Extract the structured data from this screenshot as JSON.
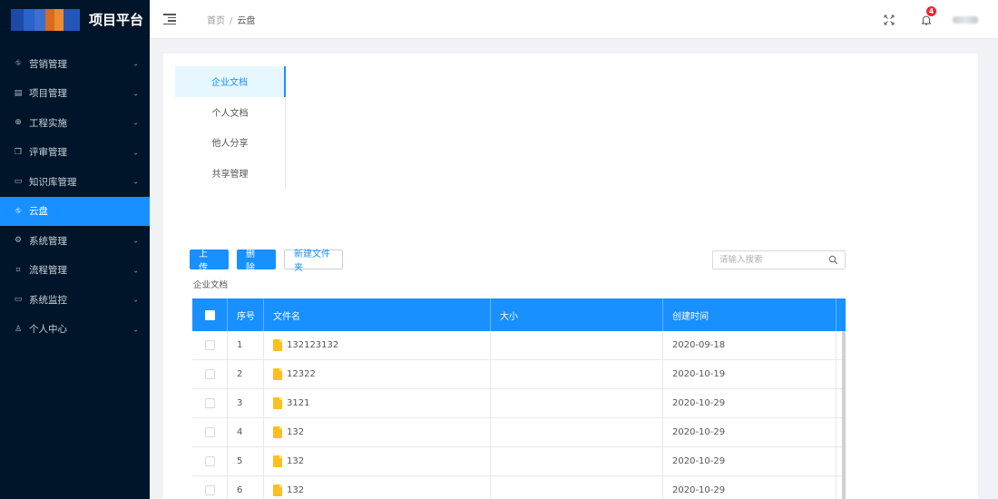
{
  "app": {
    "title": "项目平台"
  },
  "sidebar": {
    "items": [
      {
        "label": "营销管理",
        "icon": "cluster-icon",
        "glyph": "⛗",
        "active": false
      },
      {
        "label": "项目管理",
        "icon": "file-icon",
        "glyph": "▤",
        "active": false
      },
      {
        "label": "工程实施",
        "icon": "globe-icon",
        "glyph": "⊕",
        "active": false
      },
      {
        "label": "评审管理",
        "icon": "copy-icon",
        "glyph": "❐",
        "active": false
      },
      {
        "label": "知识库管理",
        "icon": "book-icon",
        "glyph": "▭",
        "active": false
      },
      {
        "label": "云盘",
        "icon": "cloud-drive-icon",
        "glyph": "⛗",
        "active": true
      },
      {
        "label": "系统管理",
        "icon": "settings-icon",
        "glyph": "⚙",
        "active": false
      },
      {
        "label": "流程管理",
        "icon": "flow-icon",
        "glyph": "⌗",
        "active": false
      },
      {
        "label": "系统监控",
        "icon": "video-icon",
        "glyph": "▭",
        "active": false
      },
      {
        "label": "个人中心",
        "icon": "user-icon",
        "glyph": "♙",
        "active": false
      }
    ]
  },
  "header": {
    "breadcrumb": {
      "home": "首页",
      "separator": "/",
      "current": "云盘"
    },
    "notification_count": "4"
  },
  "tabs": [
    {
      "label": "企业文档",
      "active": true
    },
    {
      "label": "个人文档",
      "active": false
    },
    {
      "label": "他人分享",
      "active": false
    },
    {
      "label": "共享管理",
      "active": false
    }
  ],
  "toolbar": {
    "upload_label": "上 传",
    "delete_label": "删 除",
    "new_folder_label": "新建文件夹"
  },
  "search": {
    "placeholder": "请输入搜索"
  },
  "folder_label": "企业文档",
  "table": {
    "columns": [
      "序号",
      "文件名",
      "大小",
      "创建时间"
    ],
    "rows": [
      {
        "index": "1",
        "name": "132123132",
        "size": "",
        "created": "2020-09-18"
      },
      {
        "index": "2",
        "name": "12322",
        "size": "",
        "created": "2020-10-19"
      },
      {
        "index": "3",
        "name": "3121",
        "size": "",
        "created": "2020-10-29"
      },
      {
        "index": "4",
        "name": "132",
        "size": "",
        "created": "2020-10-29"
      },
      {
        "index": "5",
        "name": "132",
        "size": "",
        "created": "2020-10-29"
      },
      {
        "index": "6",
        "name": "132",
        "size": "",
        "created": "2020-10-29"
      }
    ]
  },
  "colors": {
    "sidebar_bg": "#001529",
    "accent": "#1890ff",
    "badge": "#f5222d",
    "folder": "#fbbf24"
  }
}
